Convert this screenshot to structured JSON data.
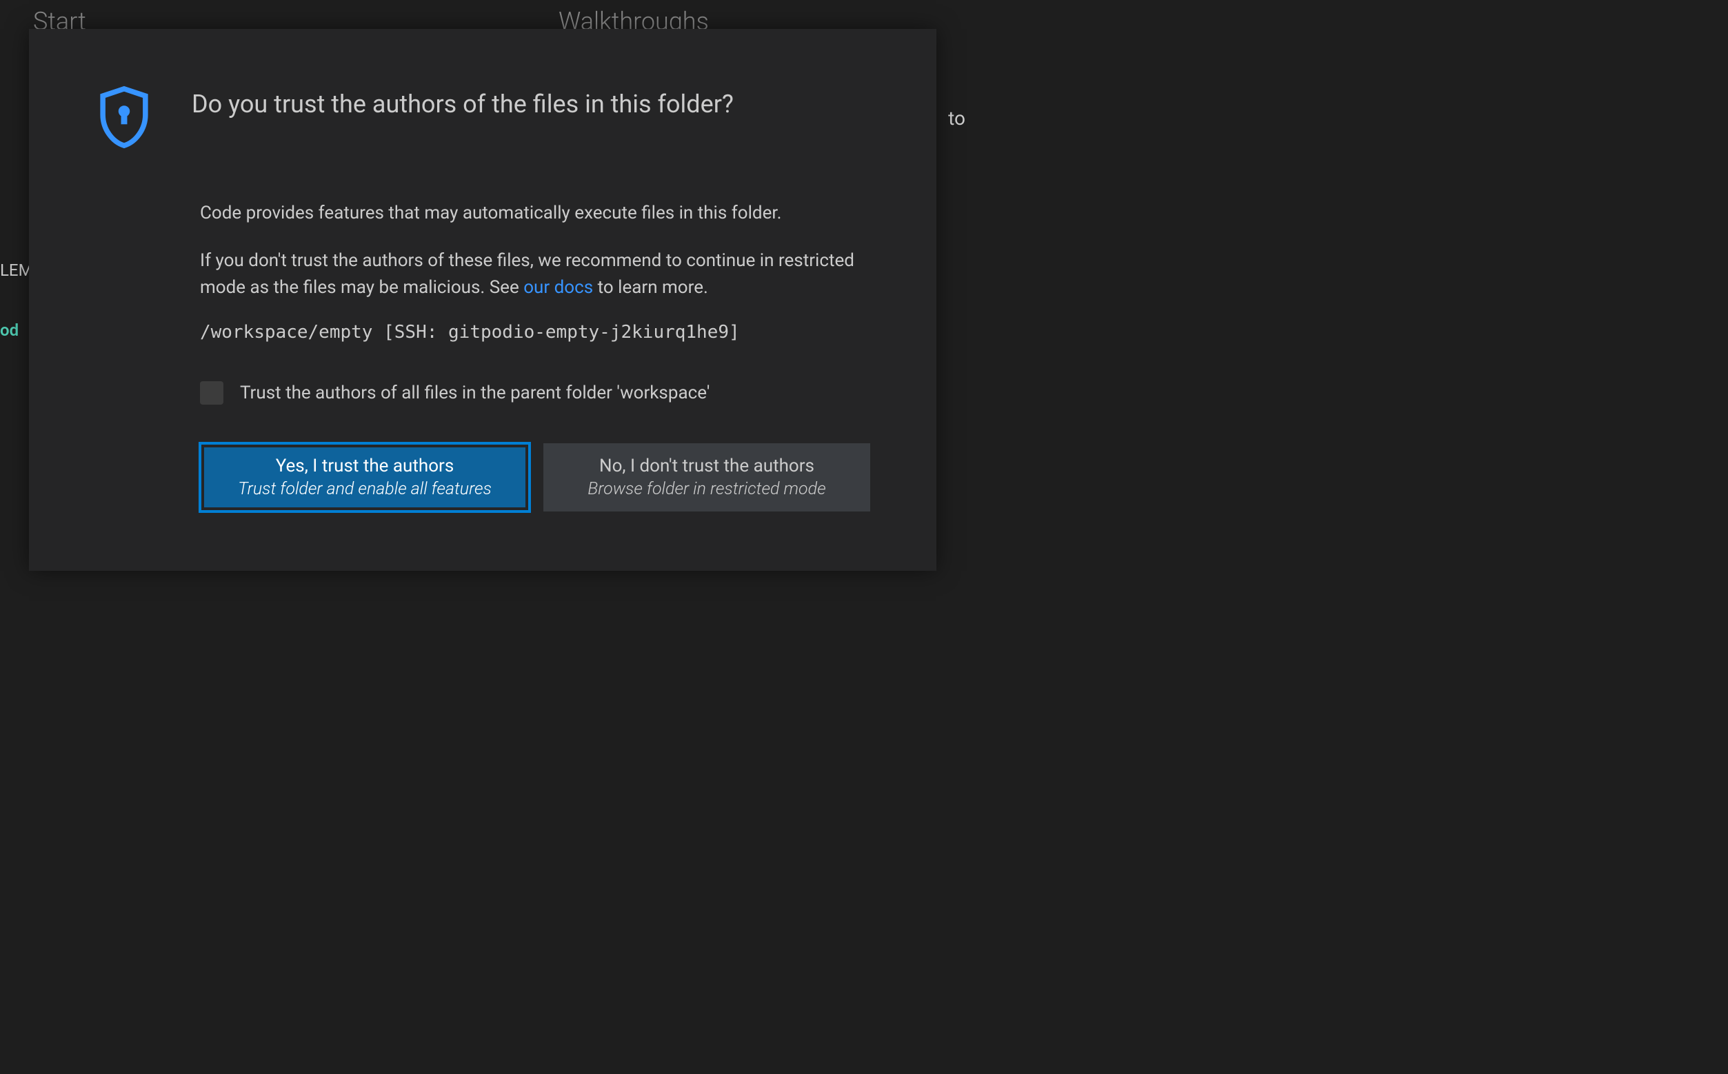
{
  "background": {
    "start": "Start",
    "walkthroughs": "Walkthroughs",
    "right_text": "to",
    "left_text1": "LEM",
    "left_text2": "od"
  },
  "dialog": {
    "title": "Do you trust the authors of the files in this folder?",
    "paragraph1": "Code provides features that may automatically execute files in this folder.",
    "paragraph2_before": "If you don't trust the authors of these files, we recommend to continue in restricted mode as the files may be malicious. See ",
    "paragraph2_link": "our docs",
    "paragraph2_after": " to learn more.",
    "path": "/workspace/empty [SSH: gitpodio-empty-j2kiurq1he9]",
    "checkbox_label": "Trust the authors of all files in the parent folder 'workspace'",
    "trust_button": {
      "title": "Yes, I trust the authors",
      "subtitle": "Trust folder and enable all features"
    },
    "dont_trust_button": {
      "title": "No, I don't trust the authors",
      "subtitle": "Browse folder in restricted mode"
    }
  }
}
